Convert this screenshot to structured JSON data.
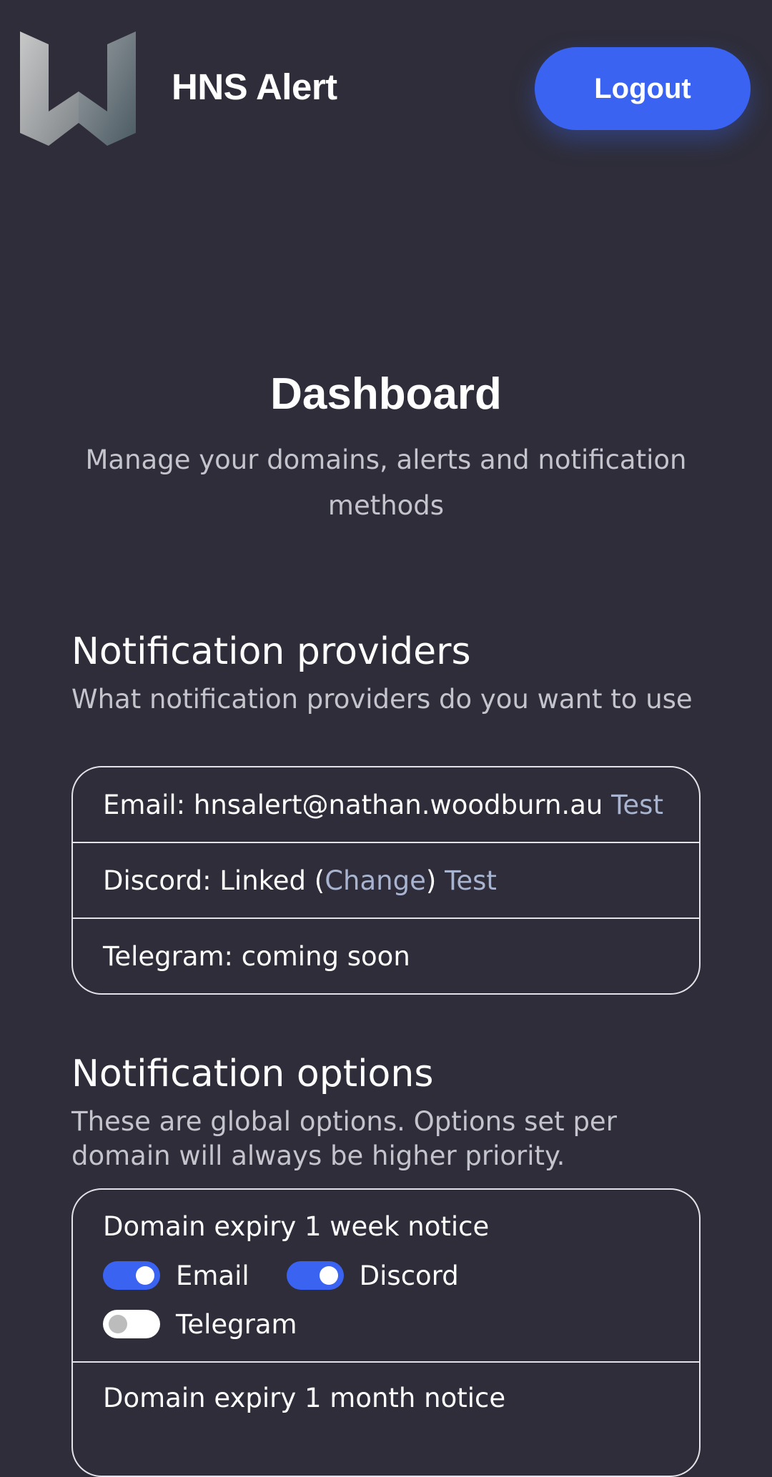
{
  "header": {
    "brand": "HNS Alert",
    "logout_label": "Logout"
  },
  "hero": {
    "title": "Dashboard",
    "subtitle": "Manage your domains, alerts and notification methods"
  },
  "providers": {
    "title": "Notification providers",
    "subtitle": "What notification providers do you want to use",
    "email_prefix": "Email: hnsalert@nathan.woodburn.au",
    "email_test": "Test",
    "discord_prefix": "Discord: Linked (",
    "discord_change": "Change",
    "discord_close": ")",
    "discord_test": "Test",
    "telegram": "Telegram: coming soon"
  },
  "options": {
    "title": "Notification options",
    "subtitle": "These are global options. Options set per domain will always be higher priority.",
    "items": [
      {
        "label": "Domain expiry 1 week notice",
        "toggles": [
          {
            "label": "Email",
            "on": true
          },
          {
            "label": "Discord",
            "on": true
          },
          {
            "label": "Telegram",
            "on": false
          }
        ]
      },
      {
        "label": "Domain expiry 1 month notice"
      }
    ]
  },
  "colors": {
    "background": "#2e2d39",
    "accent": "#3a63f2",
    "link": "#a8b4d0"
  }
}
